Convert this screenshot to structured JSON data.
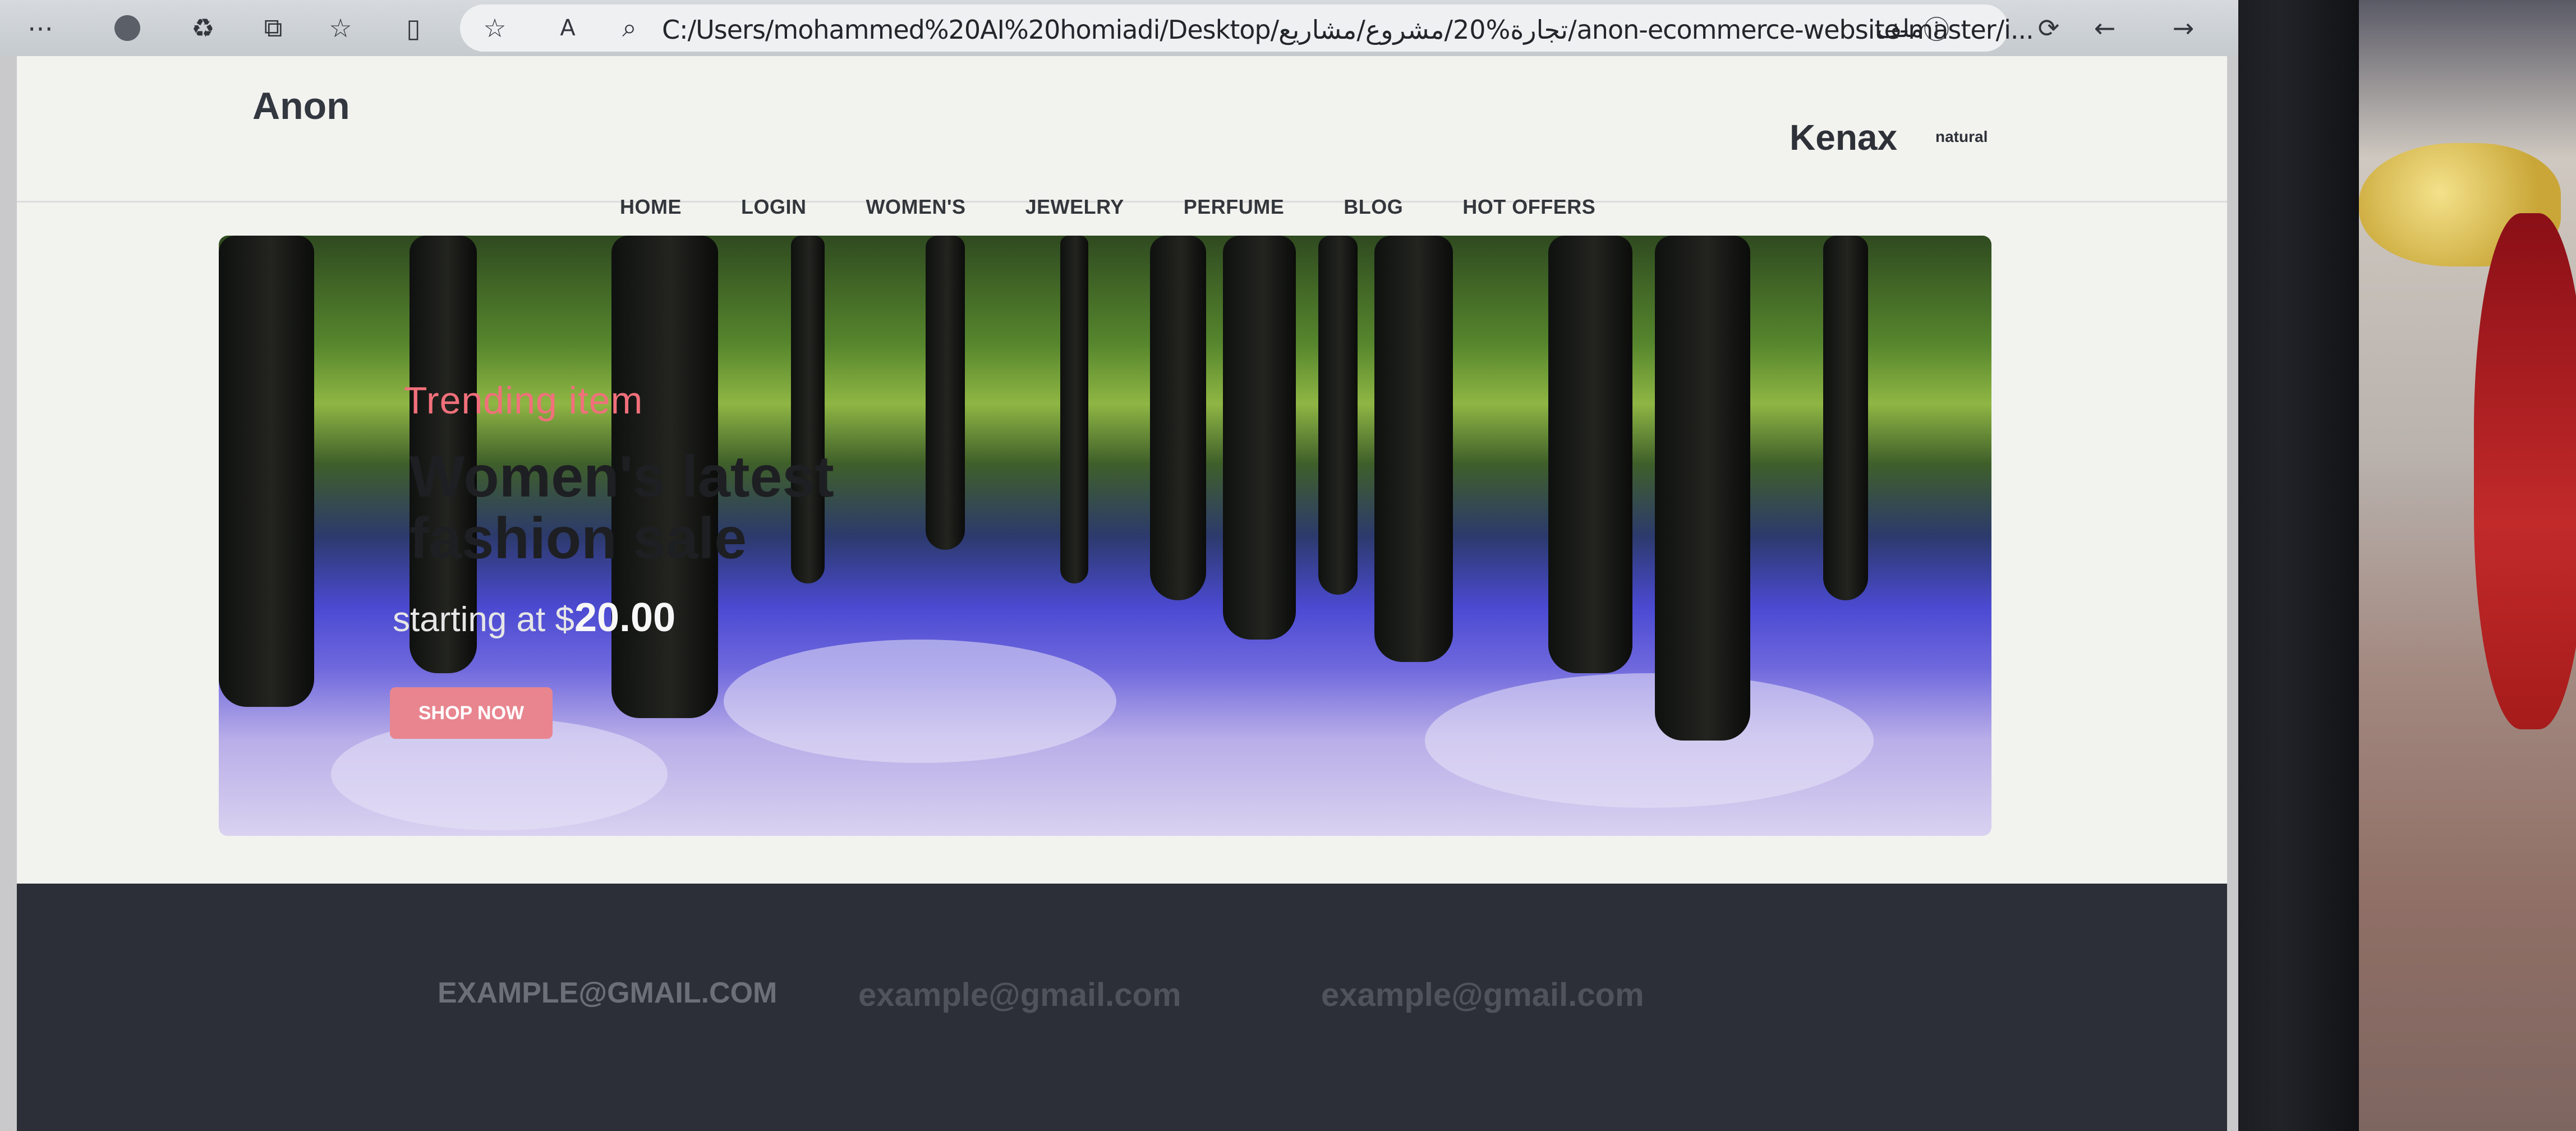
{
  "browser": {
    "url": "C:/Users/mohammed%20AI%20homiadi/Desktop/تجارة%20/مشروع/مشاريع/anon-ecommerce-website-master/i...",
    "page_info_label": "ملف",
    "icons": [
      "more-icon",
      "profile-icon",
      "sync-icon",
      "tab-actions-icon",
      "favorites-icon",
      "split-screen-icon",
      "star-icon",
      "read-aloud-icon",
      "search-icon",
      "info-icon",
      "refresh-icon",
      "back-icon",
      "forward-icon"
    ]
  },
  "site": {
    "logo": "Anon",
    "brand": "Kenax",
    "brand_sub": "natural"
  },
  "nav": [
    "HOME",
    "LOGIN",
    "WOMEN'S",
    "JEWELRY",
    "PERFUME",
    "BLOG",
    "HOT OFFERS"
  ],
  "hero": {
    "subtitle": "Trending item",
    "title": "Women's latest fashion sale",
    "price_label": "starting at $",
    "price": "20.00",
    "button": "SHOP NOW"
  },
  "footer": {
    "emails": [
      "EXAMPLE@GMAIL.COM",
      "example@gmail.com",
      "example@gmail.com"
    ]
  },
  "colors": {
    "accent": "#e8858f",
    "subtitle": "#f1707b",
    "footer_bg": "#2c2f37"
  }
}
